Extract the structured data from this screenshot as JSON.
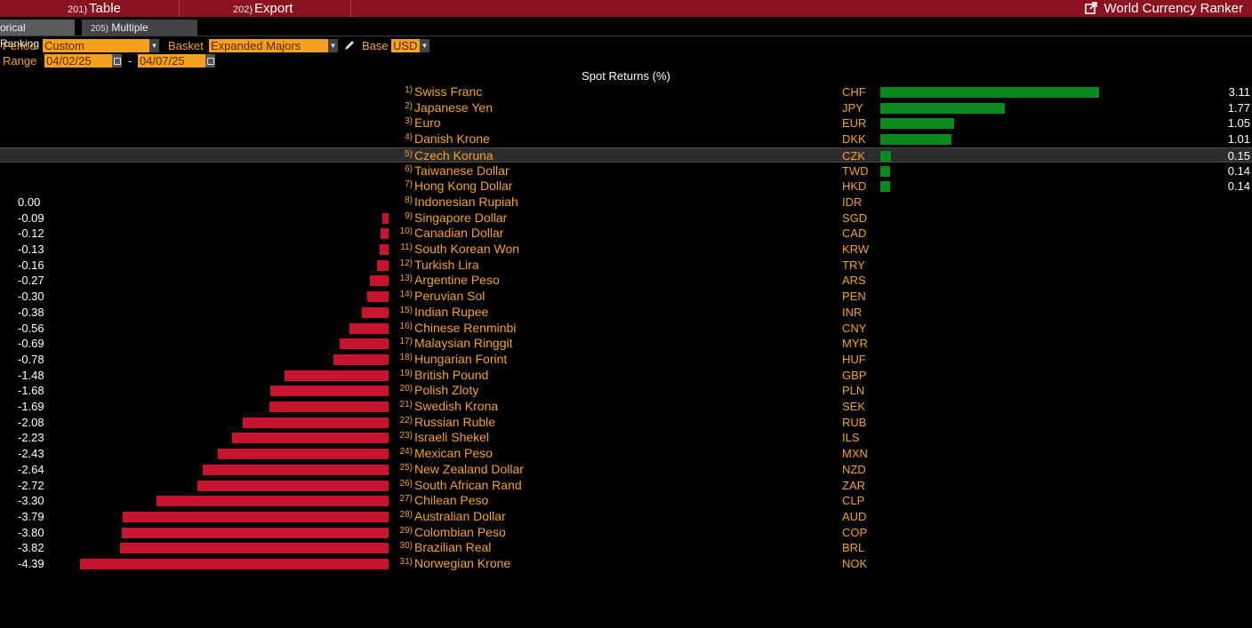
{
  "toolbar": {
    "table_num": "201)",
    "table_label": "Table",
    "export_num": "202)",
    "export_label": "Export",
    "app_title": "World Currency Ranker"
  },
  "tabs": [
    {
      "num": "",
      "label": "orical Ranking"
    },
    {
      "num": "205)",
      "label": "Multiple Ranking"
    }
  ],
  "controls": {
    "period_label": "Period",
    "period_value": "Custom",
    "basket_label": "Basket",
    "basket_value": "Expanded Majors",
    "base_label": "Base",
    "base_value": "USD",
    "range_label": "Range",
    "range_start": "04/02/25",
    "range_dash": "-",
    "range_end": "04/07/25"
  },
  "chart_data": {
    "type": "bar",
    "title": "Spot Returns (%)",
    "selected_rank": 5,
    "colors": {
      "positive": "#0b8a1f",
      "negative": "#c8142e"
    },
    "rows": [
      {
        "rank": "1)",
        "name": "Swiss Franc",
        "code": "CHF",
        "value": 3.11,
        "label": "3.11"
      },
      {
        "rank": "2)",
        "name": "Japanese Yen",
        "code": "JPY",
        "value": 1.77,
        "label": "1.77"
      },
      {
        "rank": "3)",
        "name": "Euro",
        "code": "EUR",
        "value": 1.05,
        "label": "1.05"
      },
      {
        "rank": "4)",
        "name": "Danish Krone",
        "code": "DKK",
        "value": 1.01,
        "label": "1.01"
      },
      {
        "rank": "5)",
        "name": "Czech Koruna",
        "code": "CZK",
        "value": 0.15,
        "label": "0.15"
      },
      {
        "rank": "6)",
        "name": "Taiwanese Dollar",
        "code": "TWD",
        "value": 0.14,
        "label": "0.14"
      },
      {
        "rank": "7)",
        "name": "Hong Kong Dollar",
        "code": "HKD",
        "value": 0.14,
        "label": "0.14"
      },
      {
        "rank": "8)",
        "name": "Indonesian Rupiah",
        "code": "IDR",
        "value": 0.0,
        "label": "0.00"
      },
      {
        "rank": "9)",
        "name": "Singapore Dollar",
        "code": "SGD",
        "value": -0.09,
        "label": "-0.09"
      },
      {
        "rank": "10)",
        "name": "Canadian Dollar",
        "code": "CAD",
        "value": -0.12,
        "label": "-0.12"
      },
      {
        "rank": "11)",
        "name": "South Korean Won",
        "code": "KRW",
        "value": -0.13,
        "label": "-0.13"
      },
      {
        "rank": "12)",
        "name": "Turkish Lira",
        "code": "TRY",
        "value": -0.16,
        "label": "-0.16"
      },
      {
        "rank": "13)",
        "name": "Argentine Peso",
        "code": "ARS",
        "value": -0.27,
        "label": "-0.27"
      },
      {
        "rank": "14)",
        "name": "Peruvian Sol",
        "code": "PEN",
        "value": -0.3,
        "label": "-0.30"
      },
      {
        "rank": "15)",
        "name": "Indian Rupee",
        "code": "INR",
        "value": -0.38,
        "label": "-0.38"
      },
      {
        "rank": "16)",
        "name": "Chinese Renminbi",
        "code": "CNY",
        "value": -0.56,
        "label": "-0.56"
      },
      {
        "rank": "17)",
        "name": "Malaysian Ringgit",
        "code": "MYR",
        "value": -0.69,
        "label": "-0.69"
      },
      {
        "rank": "18)",
        "name": "Hungarian Forint",
        "code": "HUF",
        "value": -0.78,
        "label": "-0.78"
      },
      {
        "rank": "19)",
        "name": "British Pound",
        "code": "GBP",
        "value": -1.48,
        "label": "-1.48"
      },
      {
        "rank": "20)",
        "name": "Polish Zloty",
        "code": "PLN",
        "value": -1.68,
        "label": "-1.68"
      },
      {
        "rank": "21)",
        "name": "Swedish Krona",
        "code": "SEK",
        "value": -1.69,
        "label": "-1.69"
      },
      {
        "rank": "22)",
        "name": "Russian Ruble",
        "code": "RUB",
        "value": -2.08,
        "label": "-2.08"
      },
      {
        "rank": "23)",
        "name": "Israeli Shekel",
        "code": "ILS",
        "value": -2.23,
        "label": "-2.23"
      },
      {
        "rank": "24)",
        "name": "Mexican Peso",
        "code": "MXN",
        "value": -2.43,
        "label": "-2.43"
      },
      {
        "rank": "25)",
        "name": "New Zealand Dollar",
        "code": "NZD",
        "value": -2.64,
        "label": "-2.64"
      },
      {
        "rank": "26)",
        "name": "South African Rand",
        "code": "ZAR",
        "value": -2.72,
        "label": "-2.72"
      },
      {
        "rank": "27)",
        "name": "Chilean Peso",
        "code": "CLP",
        "value": -3.3,
        "label": "-3.30"
      },
      {
        "rank": "28)",
        "name": "Australian Dollar",
        "code": "AUD",
        "value": -3.79,
        "label": "-3.79"
      },
      {
        "rank": "29)",
        "name": "Colombian Peso",
        "code": "COP",
        "value": -3.8,
        "label": "-3.80"
      },
      {
        "rank": "30)",
        "name": "Brazilian Real",
        "code": "BRL",
        "value": -3.82,
        "label": "-3.82"
      },
      {
        "rank": "31)",
        "name": "Norwegian Krone",
        "code": "NOK",
        "value": -4.39,
        "label": "-4.39"
      }
    ]
  }
}
